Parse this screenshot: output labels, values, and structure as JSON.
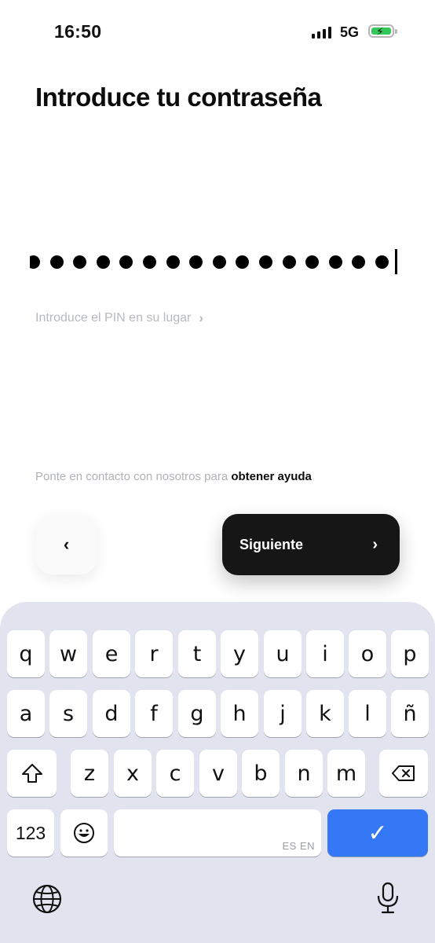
{
  "status_bar": {
    "time": "16:50",
    "network": "5G"
  },
  "screen": {
    "title": "Introduce tu contraseña",
    "pin_link": "Introduce el PIN en su lugar",
    "help_prefix": "Ponte en contacto con nosotros para",
    "help_link": "obtener ayuda",
    "back_label": "‹",
    "next_label": "Siguiente",
    "next_chevron": "›"
  },
  "keyboard": {
    "row1": [
      "q",
      "w",
      "e",
      "r",
      "t",
      "y",
      "u",
      "i",
      "o",
      "p"
    ],
    "row2": [
      "a",
      "s",
      "d",
      "f",
      "g",
      "h",
      "j",
      "k",
      "l",
      "ñ"
    ],
    "row3": [
      "z",
      "x",
      "c",
      "v",
      "b",
      "n",
      "m"
    ],
    "numbers_key": "123",
    "space_lang": "ES EN",
    "done_glyph": "✓",
    "emoji_glyph": "☺"
  },
  "icons": {
    "signal": "signal-bars-icon",
    "battery": "battery-charging-icon",
    "shift": "shift-icon",
    "backspace": "backspace-icon",
    "globe": "globe-icon",
    "mic": "microphone-icon"
  },
  "colors": {
    "accent": "#3478f6",
    "battery": "#34c759",
    "button_dark": "#161616"
  }
}
